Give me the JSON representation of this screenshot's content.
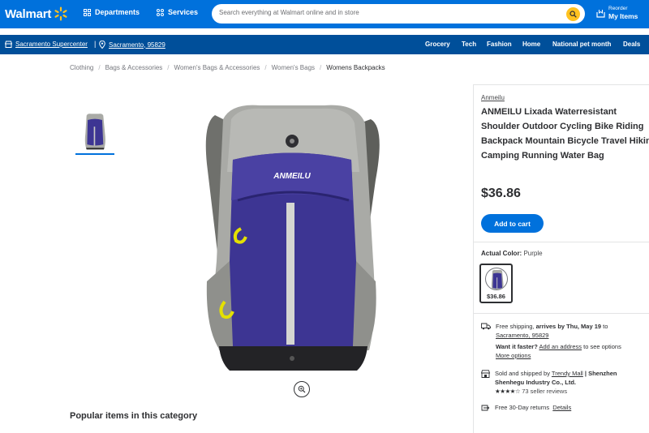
{
  "header": {
    "logo_text": "Walmart",
    "departments_label": "Departments",
    "services_label": "Services",
    "search_placeholder": "Search everything at Walmart online and in store",
    "reorder_small": "Reorder",
    "reorder_big": "My Items"
  },
  "subbar": {
    "store": "Sacramento Supercenter",
    "zip": "Sacramento, 95829",
    "nav": [
      "Grocery",
      "Tech",
      "Fashion",
      "Home",
      "National pet month",
      "Deals"
    ]
  },
  "breadcrumb": [
    "Clothing",
    "Bags & Accessories",
    "Women's Bags & Accessories",
    "Women's Bags",
    "Womens Backpacks"
  ],
  "product": {
    "brand": "Anmeilu",
    "title_lines": [
      "ANMEILU Lixada Waterresistant",
      "Shoulder Outdoor Cycling Bike Riding",
      "Backpack Mountain Bicycle Travel Hiking",
      "Camping Running Water Bag"
    ],
    "price": "$36.86",
    "add_to_cart": "Add to cart",
    "color_label": "Actual Color:",
    "color_value": "Purple",
    "swatch_price": "$36.86",
    "logo_on_bag": "ANMEILU"
  },
  "fulfillment": {
    "shipping_prefix": "Free shipping, ",
    "shipping_bold": "arrives by Thu, May 19",
    "shipping_to": " to",
    "shipping_loc": "Sacramento, 95829",
    "faster_prefix": "Want it faster?",
    "add_address": "Add an address",
    "faster_suffix": " to see options",
    "more_options": "More options",
    "sold_prefix": "Sold and shipped by ",
    "seller": "Trendy Mall",
    "seller_rest": " | Shenzhen",
    "seller_line2": "Shenhegu Industry Co., Ltd.",
    "stars": "★★★★☆",
    "reviews": "73 seller reviews",
    "returns": "Free 30-Day returns",
    "details": "Details"
  },
  "popular_title": "Popular items in this category",
  "colors": {
    "primary": "#0071dc",
    "dark_blue": "#004f9a",
    "yellow": "#ffc220",
    "bag_purple": "#3d3593",
    "bag_gray": "#a9aaa6"
  }
}
